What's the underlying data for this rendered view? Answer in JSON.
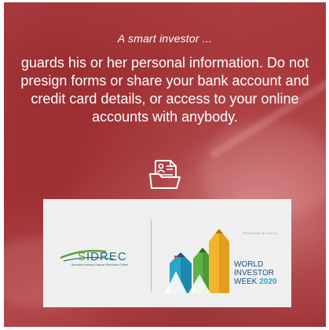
{
  "lead_in": "A smart investor ...",
  "message": "guards his or her personal information. Do not presign forms or share your bank account and credit card details, or access to your online accounts with anybody.",
  "icon": "form-folder-icon",
  "logos": {
    "sidrec": {
      "name": "SIDREC",
      "subtitle": "Securities Industry Dispute Resolution Center"
    },
    "wiw": {
      "promo_text": "PROMOTED BY IOSCO",
      "line1": "WORLD",
      "line2": "INVESTOR",
      "line3": "WEEK",
      "year": "2020"
    }
  },
  "colors": {
    "background_red": "#a8383b",
    "text": "#ffffff",
    "card": "#efefef",
    "sidrec_green": "#5aa43a",
    "sidrec_blue": "#1d6b7a",
    "wiw_blue": "#1d4f8a",
    "wiw_cyan": "#2ba5c8",
    "pencil_green": "#5fb246",
    "pencil_yellow": "#f1b52e",
    "pencil_red": "#e0433c"
  }
}
